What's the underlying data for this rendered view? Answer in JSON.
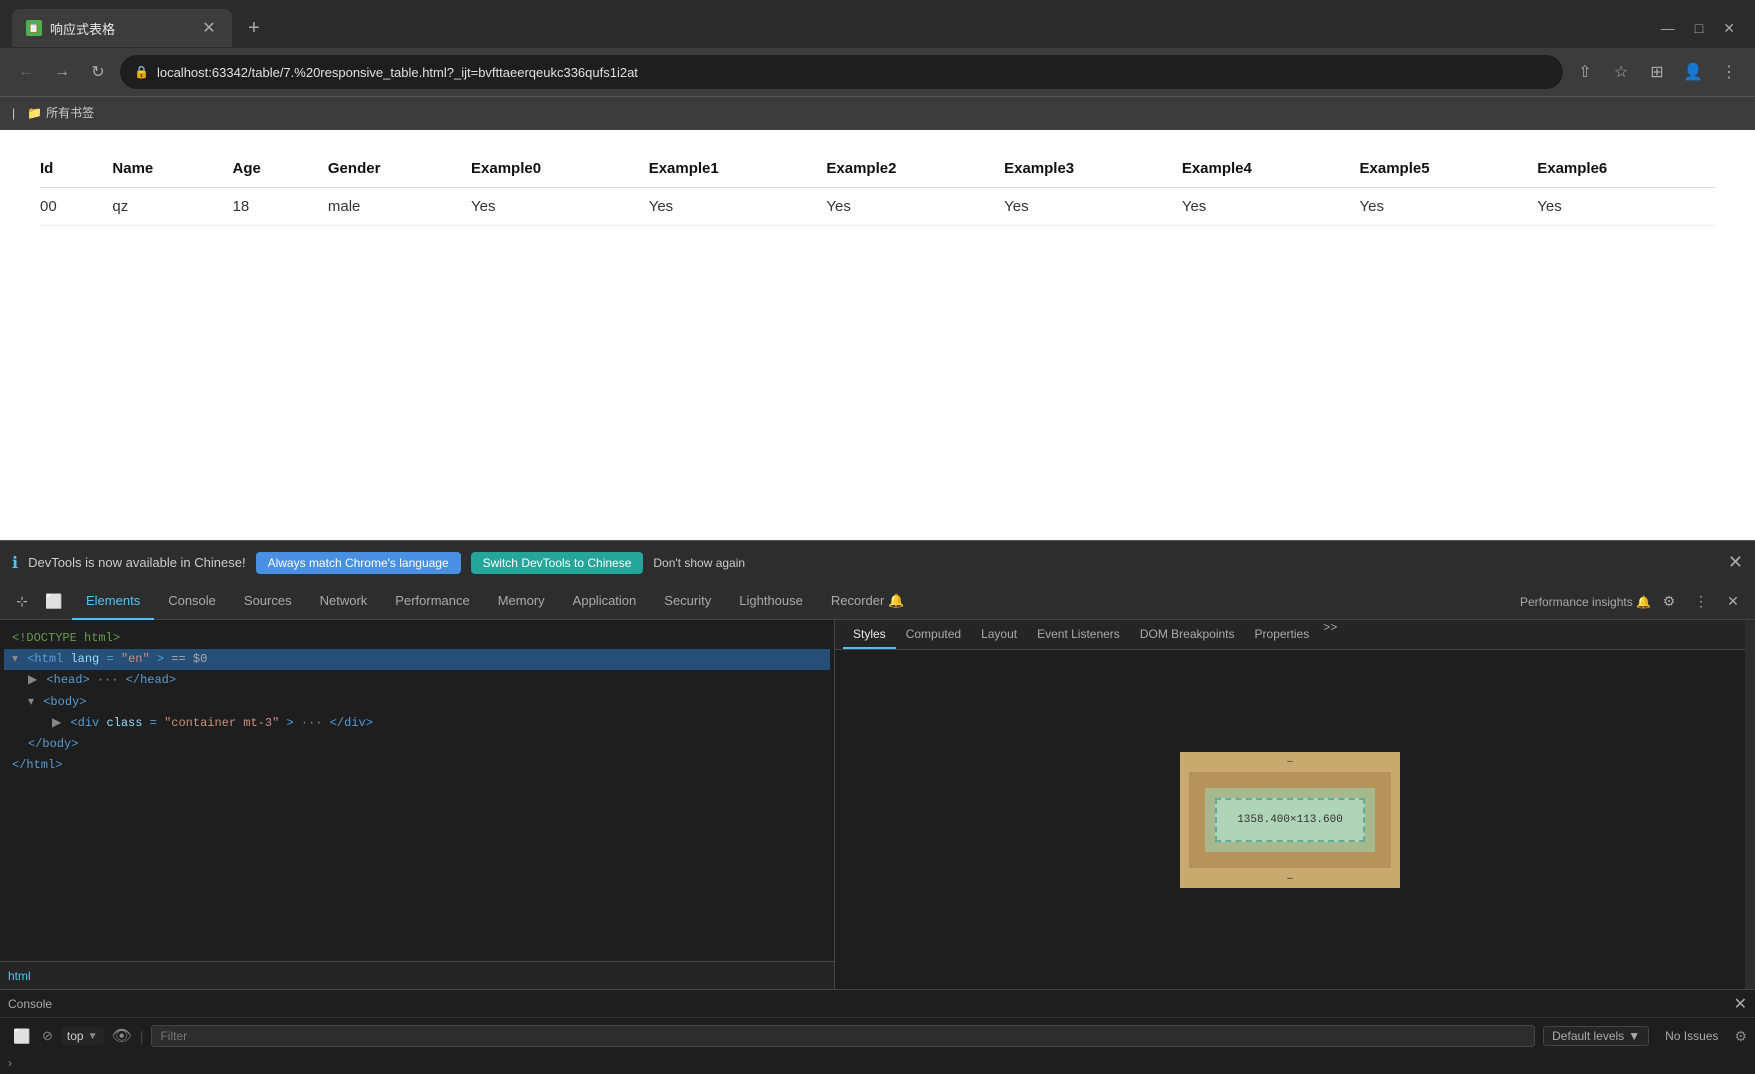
{
  "browser": {
    "tab_favicon": "📋",
    "tab_title": "响应式表格",
    "new_tab_icon": "+",
    "window_controls": [
      "⌄",
      "—",
      "□",
      "✕"
    ],
    "back_icon": "←",
    "forward_icon": "→",
    "refresh_icon": "↻",
    "address_lock": "🔒",
    "address_url": "localhost:63342/table/7.%20responsive_table.html?_ijt=bvfttaeerqeukc336qufs1i2at",
    "share_icon": "⇧",
    "star_icon": "☆",
    "extensions_icon": "⊞",
    "profile_icon": "👤",
    "menu_icon": "⋮",
    "bookmarks_divider": "|",
    "bookmarks_label": "所有书签"
  },
  "table": {
    "headers": [
      "Id",
      "Name",
      "Age",
      "Gender",
      "Example0",
      "Example1",
      "Example2",
      "Example3",
      "Example4",
      "Example5",
      "Example6"
    ],
    "rows": [
      [
        "00",
        "qz",
        "18",
        "male",
        "Yes",
        "Yes",
        "Yes",
        "Yes",
        "Yes",
        "Yes",
        "Yes"
      ]
    ]
  },
  "devtools_notification": {
    "icon": "ℹ",
    "text": "DevTools is now available in Chinese!",
    "btn1": "Always match Chrome's language",
    "btn2": "Switch DevTools to Chinese",
    "btn3": "Don't show again",
    "close": "✕"
  },
  "devtools": {
    "tabs": [
      {
        "label": "Elements",
        "active": true
      },
      {
        "label": "Console",
        "active": false
      },
      {
        "label": "Sources",
        "active": false
      },
      {
        "label": "Network",
        "active": false
      },
      {
        "label": "Performance",
        "active": false
      },
      {
        "label": "Memory",
        "active": false
      },
      {
        "label": "Application",
        "active": false
      },
      {
        "label": "Security",
        "active": false
      },
      {
        "label": "Lighthouse",
        "active": false
      },
      {
        "label": "Recorder 🔔",
        "active": false
      }
    ],
    "perf_insights": "Performance insights 🔔",
    "gear_icon": "⚙",
    "more_icon": "⋮",
    "close_icon": "✕",
    "inspect_icon": "⊹",
    "device_icon": "⬜"
  },
  "dom": {
    "lines": [
      {
        "indent": 0,
        "content": "<!DOCTYPE html>",
        "type": "comment"
      },
      {
        "indent": 0,
        "content": "<html lang=\"en\"> == $0",
        "type": "tag",
        "selected": true
      },
      {
        "indent": 1,
        "content": "<head> ··· </head>",
        "type": "tag"
      },
      {
        "indent": 1,
        "content": "<body>",
        "type": "tag"
      },
      {
        "indent": 2,
        "content": "<div class=\"container mt-3\"> ··· </div>",
        "type": "tag"
      },
      {
        "indent": 1,
        "content": "</body>",
        "type": "tag"
      },
      {
        "indent": 0,
        "content": "</html>",
        "type": "tag"
      }
    ]
  },
  "styles_tabs": [
    "Styles",
    "Computed",
    "Layout",
    "Event Listeners",
    "DOM Breakpoints",
    "Properties",
    ">>"
  ],
  "breadcrumb": "html",
  "box_model": {
    "content_size": "1358.400×113.600",
    "padding_dash": "–",
    "border_dash": "–",
    "margin_dash": "–"
  },
  "console": {
    "label": "Console",
    "close_icon": "✕",
    "prompt_icon": "⊘",
    "top_label": "top",
    "top_arrow": "▼",
    "eye_icon": "👁",
    "filter_placeholder": "Filter",
    "levels_label": "Default levels",
    "levels_arrow": "▼",
    "issues_label": "No Issues",
    "gear_icon": "⚙",
    "chevron": "›",
    "devtools_icon": "⬜"
  }
}
